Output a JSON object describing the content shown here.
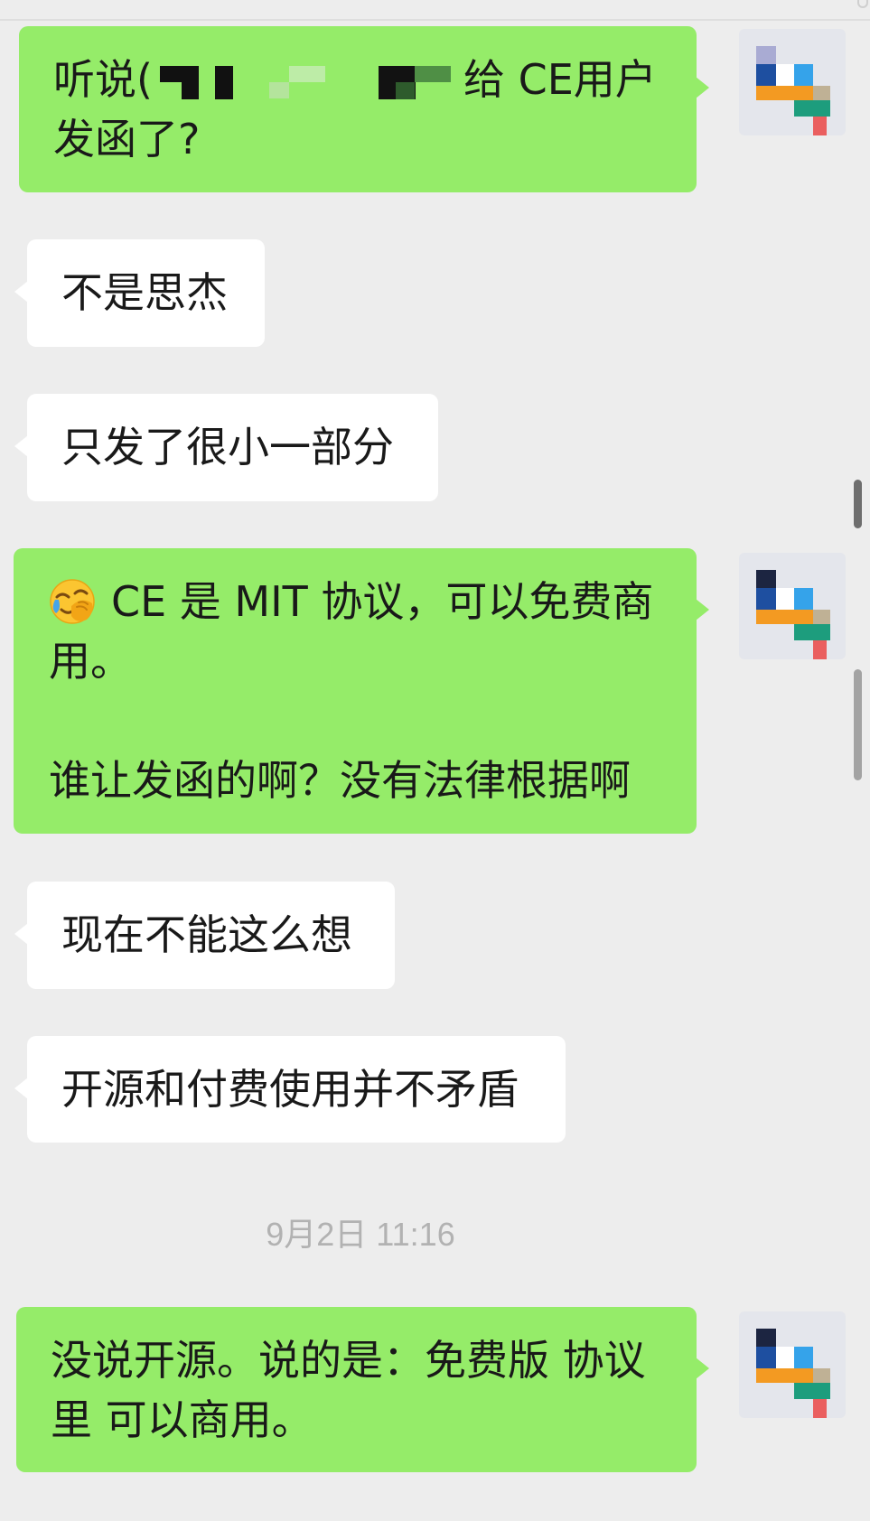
{
  "theme": {
    "background": "#ededed",
    "sent_bubble": "#95ec69",
    "received_bubble": "#ffffff",
    "text": "#191919",
    "timestamp": "#b2b2b2"
  },
  "messages": [
    {
      "line1_prefix": "听说(",
      "line1_suffix": "给 CE用户",
      "line2": "发函了?"
    },
    {
      "text": "不是思杰"
    },
    {
      "text": "只发了很小一部分"
    },
    {
      "emoji": "facepalm-emoji",
      "paragraphs": [
        [
          "CE 是 MIT 协议，可以免费商",
          "用。"
        ],
        [
          "谁让发函的啊？没有法律根据啊"
        ]
      ]
    },
    {
      "text": "现在不能这么想"
    },
    {
      "text": "开源和付费使用并不矛盾"
    },
    {
      "lines": [
        "没说开源。说的是：免费版 协议",
        "里 可以商用。"
      ]
    }
  ],
  "timestamp": "9月2日 11:16"
}
